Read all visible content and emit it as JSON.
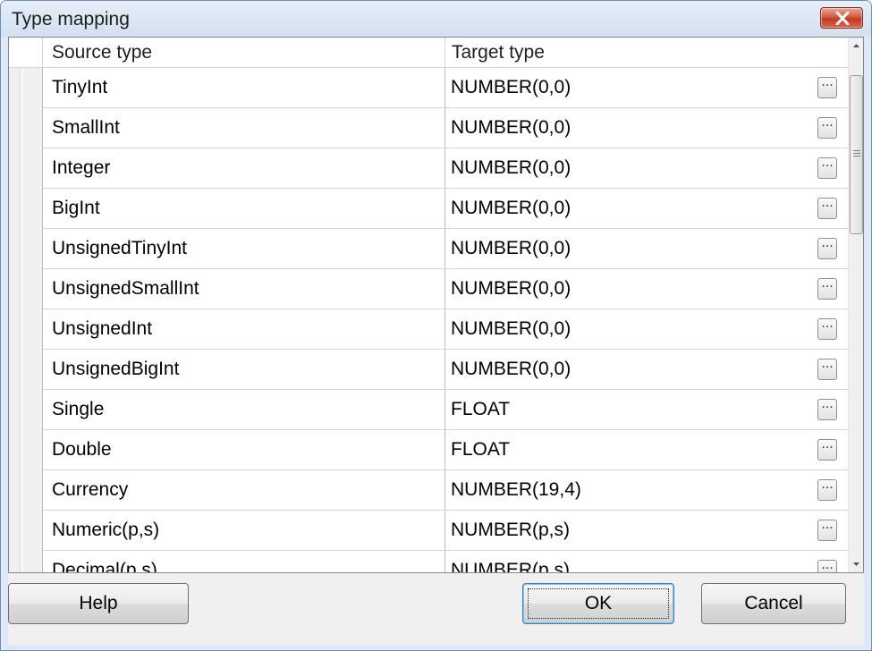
{
  "window": {
    "title": "Type mapping",
    "close_icon": "close-x-icon"
  },
  "grid": {
    "columns": [
      "Source type",
      "Target type"
    ],
    "rows": [
      {
        "source": "TinyInt",
        "target": "NUMBER(0,0)"
      },
      {
        "source": "SmallInt",
        "target": "NUMBER(0,0)"
      },
      {
        "source": "Integer",
        "target": "NUMBER(0,0)"
      },
      {
        "source": "BigInt",
        "target": "NUMBER(0,0)"
      },
      {
        "source": "UnsignedTinyInt",
        "target": "NUMBER(0,0)"
      },
      {
        "source": "UnsignedSmallInt",
        "target": "NUMBER(0,0)"
      },
      {
        "source": "UnsignedInt",
        "target": "NUMBER(0,0)"
      },
      {
        "source": "UnsignedBigInt",
        "target": "NUMBER(0,0)"
      },
      {
        "source": "Single",
        "target": "FLOAT"
      },
      {
        "source": "Double",
        "target": "FLOAT"
      },
      {
        "source": "Currency",
        "target": "NUMBER(19,4)"
      },
      {
        "source": "Numeric(p,s)",
        "target": "NUMBER(p,s)"
      },
      {
        "source": "Decimal(p,s)",
        "target": "NUMBER(p,s)"
      }
    ],
    "ellipsis_label": "···"
  },
  "buttons": {
    "help": "Help",
    "ok": "OK",
    "cancel": "Cancel"
  },
  "colors": {
    "titlebar": "#dfe9f5",
    "close_button": "#c23a20",
    "grid_lines": "#d5d5d5"
  }
}
